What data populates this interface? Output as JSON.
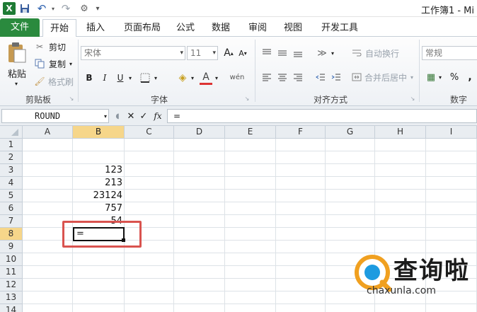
{
  "app": {
    "title": "工作簿1 - Mi",
    "accent": "#2a8a3e"
  },
  "quick_access": [
    {
      "name": "excel-logo-icon",
      "glyph": "X"
    },
    {
      "name": "save-icon",
      "glyph": "💾"
    },
    {
      "name": "undo-icon",
      "glyph": "↶"
    },
    {
      "name": "redo-icon",
      "glyph": "↷"
    },
    {
      "name": "customize-icon",
      "glyph": "⚙"
    }
  ],
  "tabs": [
    {
      "label": "文件",
      "kind": "file"
    },
    {
      "label": "开始",
      "kind": "active"
    },
    {
      "label": "插入"
    },
    {
      "label": "页面布局"
    },
    {
      "label": "公式"
    },
    {
      "label": "数据"
    },
    {
      "label": "审阅"
    },
    {
      "label": "视图"
    },
    {
      "label": "开发工具"
    }
  ],
  "ribbon": {
    "clipboard": {
      "paste": "粘贴",
      "cut": "剪切",
      "copy": "复制",
      "format_painter": "格式刷",
      "label": "剪贴板"
    },
    "font": {
      "font_name": "宋体",
      "font_size": "11",
      "bold": "B",
      "italic": "I",
      "underline": "U",
      "grow": "A",
      "shrink": "A",
      "font_color": "A",
      "wen": "wén",
      "label": "字体"
    },
    "alignment": {
      "wrap_text": "自动换行",
      "merge_center": "合并后居中",
      "label": "对齐方式"
    },
    "number": {
      "format": "常规",
      "percent": "%",
      "comma": ",",
      "label": "数字"
    }
  },
  "formula_bar": {
    "name_box": "ROUND",
    "cancel": "✕",
    "enter": "✓",
    "fx": "fx",
    "content": "="
  },
  "sheet": {
    "columns": [
      "A",
      "B",
      "C",
      "D",
      "E",
      "F",
      "G",
      "H",
      "I"
    ],
    "selected_column": "B",
    "rows": [
      "1",
      "2",
      "3",
      "4",
      "5",
      "6",
      "7",
      "8",
      "9",
      "10",
      "11",
      "12",
      "13",
      "14"
    ],
    "selected_row": "8",
    "cells": [
      {
        "ref": "B3",
        "value": "123"
      },
      {
        "ref": "B4",
        "value": "213"
      },
      {
        "ref": "B5",
        "value": "23124"
      },
      {
        "ref": "B6",
        "value": "757"
      },
      {
        "ref": "B7",
        "value": "54"
      }
    ],
    "active_cell": {
      "ref": "B8",
      "value": "="
    },
    "highlight_color": "#d9534f"
  },
  "watermark": {
    "text": "查询啦",
    "url": "chaxunla.com",
    "logo_color": "#f0a020"
  }
}
